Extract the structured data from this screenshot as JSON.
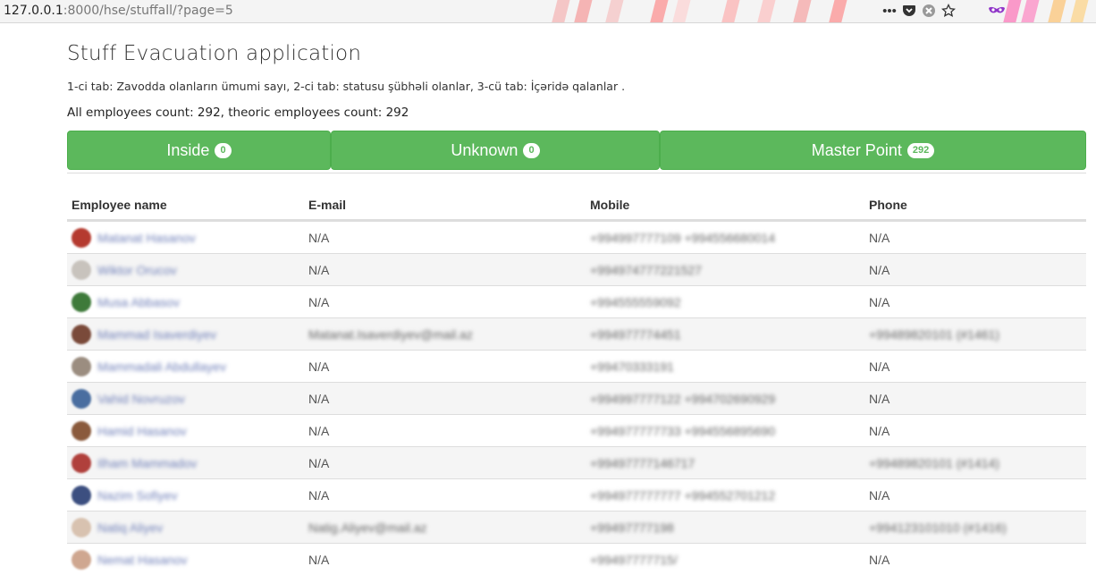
{
  "browser": {
    "url_host": "127.0.0.1",
    "url_rest": ":8000/hse/stuffall/?page=5"
  },
  "page": {
    "title": "Stuff Evacuation application",
    "subtitle": "1-ci tab: Zavodda olanların ümumi sayı, 2-ci tab: statusu şübhəli olanlar, 3-cü tab: İçəridə qalanlar .",
    "counts_text": "All employees count: 292, theoric employees count: 292"
  },
  "tabs": [
    {
      "label": "Inside",
      "badge": "0"
    },
    {
      "label": "Unknown",
      "badge": "0"
    },
    {
      "label": "Master Point",
      "badge": "292"
    }
  ],
  "table": {
    "headers": [
      "Employee name",
      "E-mail",
      "Mobile",
      "Phone"
    ],
    "rows": [
      {
        "name": "Matanat Hasanov",
        "email": "N/A",
        "mobile": "+994997777109 +994556680014",
        "phone": "N/A",
        "avatar": "#b53a2f"
      },
      {
        "name": "Wiktor Orucov",
        "email": "N/A",
        "mobile": "+994974777221527",
        "phone": "N/A",
        "avatar": "#c8c3bd"
      },
      {
        "name": "Musa Abbasov",
        "email": "N/A",
        "mobile": "+994555559092",
        "phone": "N/A",
        "avatar": "#3e7a3a"
      },
      {
        "name": "Mammad Isaverdiyev",
        "email": "Matanat.Isaverdiyev@mail.az",
        "mobile": "+994977774451",
        "phone": "+99489820101 (#1461)",
        "avatar": "#7a4a3a"
      },
      {
        "name": "Mammadali Abdullayev",
        "email": "N/A",
        "mobile": "+99470333191",
        "phone": "N/A",
        "avatar": "#9b8d80"
      },
      {
        "name": "Vahid Novruzov",
        "email": "N/A",
        "mobile": "+994997777122 +994702690929",
        "phone": "N/A",
        "avatar": "#4a6ea0"
      },
      {
        "name": "Hamid Hasanov",
        "email": "N/A",
        "mobile": "+994977777733 +994556895690",
        "phone": "N/A",
        "avatar": "#8a5a3c"
      },
      {
        "name": "Ilham Mammadov",
        "email": "N/A",
        "mobile": "+99497777146717",
        "phone": "+99489820101 (#1414)",
        "avatar": "#b0403c"
      },
      {
        "name": "Nazim Sofiyev",
        "email": "N/A",
        "mobile": "+994977777777 +994552701212",
        "phone": "N/A",
        "avatar": "#3c4f80"
      },
      {
        "name": "Natiq Aliyev",
        "email": "Natig.Aliyev@mail.az",
        "mobile": "+99497777198",
        "phone": "+994123101010 (#1416)",
        "avatar": "#d8c2b0"
      },
      {
        "name": "Nemat Hasanov",
        "email": "N/A",
        "mobile": "+99497777715/",
        "phone": "N/A",
        "avatar": "#cfa790"
      }
    ]
  },
  "colors": {
    "tab_green": "#5cb85c",
    "link_blue": "#6f7fb8"
  }
}
